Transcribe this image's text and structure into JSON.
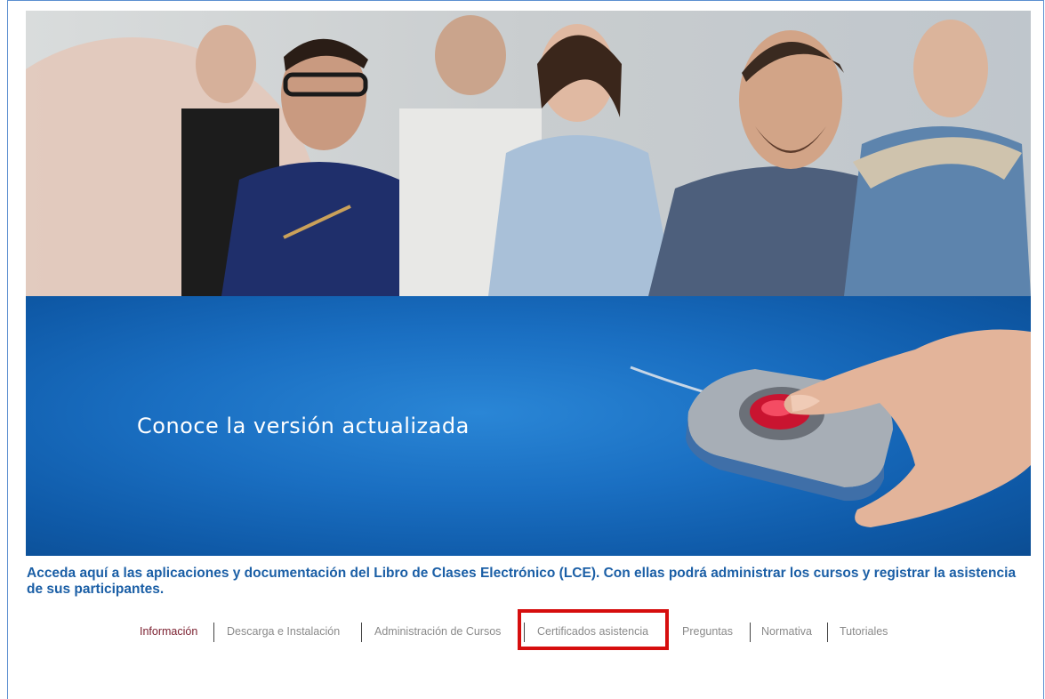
{
  "banner": {
    "headline": "Conoce la versión actualizada"
  },
  "intro": {
    "text": "Acceda aquí a las aplicaciones y documentación del Libro de Clases Electrónico (LCE). Con ellas podrá administrar los cursos y registrar la asistencia de sus participantes."
  },
  "tabs": [
    {
      "label": "Información",
      "active": true
    },
    {
      "label": "Descarga e Instalación",
      "active": false
    },
    {
      "label": "Administración de Cursos",
      "active": false
    },
    {
      "label": "Certificados asistencia",
      "active": false,
      "highlighted": true
    },
    {
      "label": "Preguntas",
      "active": false
    },
    {
      "label": "Normativa",
      "active": false
    },
    {
      "label": "Tutoriales",
      "active": false
    }
  ],
  "colors": {
    "banner_blue": "#1a6fc2",
    "intro_text": "#1b5fa6",
    "active_tab": "#7a1e2e",
    "inactive_tab": "#8a8a8a",
    "highlight": "#d60e0e"
  }
}
